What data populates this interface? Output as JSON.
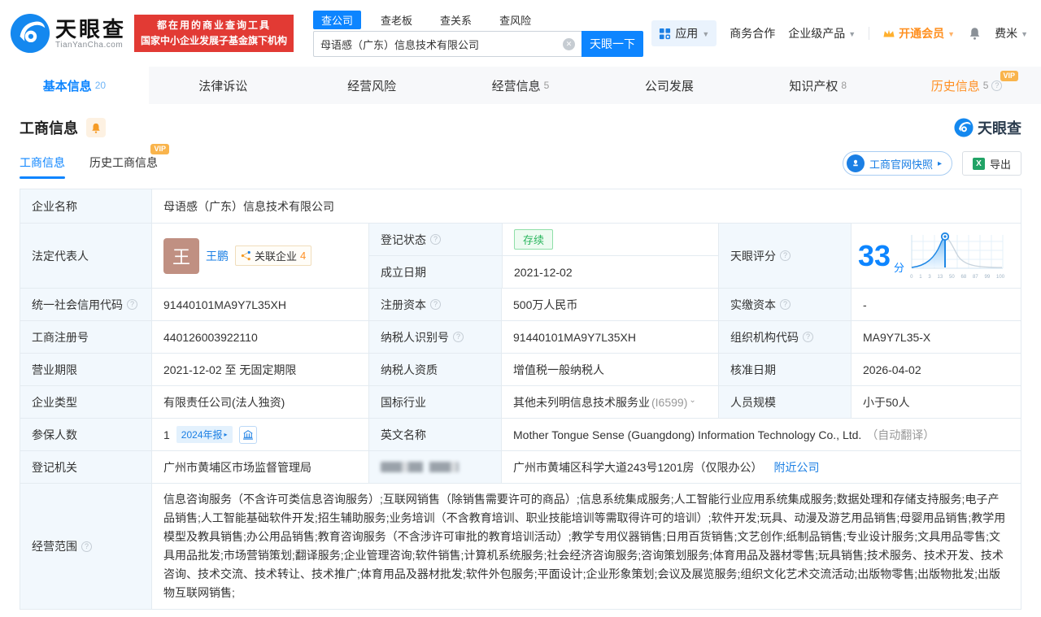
{
  "brand": {
    "name": "天眼查",
    "domain": "TianYanCha.com",
    "slogan1": "都在用的商业查询工具",
    "slogan2": "国家中小企业发展子基金旗下机构"
  },
  "search": {
    "tabs": [
      "查公司",
      "查老板",
      "查关系",
      "查风险"
    ],
    "value": "母语感（广东）信息技术有限公司",
    "button": "天眼一下"
  },
  "topnav": {
    "apps": "应用",
    "cooperation": "商务合作",
    "enterprise": "企业级产品",
    "vip": "开通会员",
    "username": "费米"
  },
  "tabs": [
    {
      "label": "基本信息",
      "count": "20"
    },
    {
      "label": "法律诉讼",
      "count": ""
    },
    {
      "label": "经营风险",
      "count": ""
    },
    {
      "label": "经营信息",
      "count": "5"
    },
    {
      "label": "公司发展",
      "count": ""
    },
    {
      "label": "知识产权",
      "count": "8"
    },
    {
      "label": "历史信息",
      "count": "5",
      "vip": "VIP"
    }
  ],
  "section": {
    "title": "工商信息",
    "watermark": "天眼查",
    "subtab1": "工商信息",
    "subtab2": "历史工商信息",
    "vip_badge": "VIP",
    "snapshot_btn": "工商官网快照",
    "export_btn": "导出"
  },
  "info": {
    "company_name_label": "企业名称",
    "company_name": "母语感（广东）信息技术有限公司",
    "legal_rep_label": "法定代表人",
    "legal_rep_avatar": "王",
    "legal_rep_name": "王鹏",
    "related_label": "关联企业",
    "related_count": "4",
    "reg_status_label": "登记状态",
    "reg_status": "存续",
    "establish_label": "成立日期",
    "establish": "2021-12-02",
    "score_label": "天眼评分",
    "score": "33",
    "score_unit": "分",
    "credit_code_label": "统一社会信用代码",
    "credit_code": "91440101MA9Y7L35XH",
    "reg_capital_label": "注册资本",
    "reg_capital": "500万人民币",
    "paid_capital_label": "实缴资本",
    "paid_capital": "-",
    "reg_no_label": "工商注册号",
    "reg_no": "440126003922110",
    "tax_id_label": "纳税人识别号",
    "tax_id": "91440101MA9Y7L35XH",
    "org_code_label": "组织机构代码",
    "org_code": "MA9Y7L35-X",
    "term_label": "营业期限",
    "term": "2021-12-02 至 无固定期限",
    "tax_quality_label": "纳税人资质",
    "tax_quality": "增值税一般纳税人",
    "approve_label": "核准日期",
    "approve": "2026-04-02",
    "type_label": "企业类型",
    "type": "有限责任公司(法人独资)",
    "industry_label": "国标行业",
    "industry": "其他未列明信息技术服务业",
    "industry_code": "(I6599)",
    "staff_label": "人员规模",
    "staff": "小于50人",
    "insured_label": "参保人数",
    "insured": "1",
    "annual_report": "2024年报",
    "en_name_label": "英文名称",
    "en_name": "Mother Tongue Sense (Guangdong) Information Technology Co., Ltd.",
    "en_note": "（自动翻译）",
    "authority_label": "登记机关",
    "authority": "广州市黄埔区市场监督管理局",
    "address": "广州市黄埔区科学大道243号1201房（仅限办公）",
    "nearby": "附近公司",
    "scope_label": "经营范围",
    "scope": "信息咨询服务（不含许可类信息咨询服务）;互联网销售（除销售需要许可的商品）;信息系统集成服务;人工智能行业应用系统集成服务;数据处理和存储支持服务;电子产品销售;人工智能基础软件开发;招生辅助服务;业务培训（不含教育培训、职业技能培训等需取得许可的培训）;软件开发;玩具、动漫及游艺用品销售;母婴用品销售;教学用模型及教具销售;办公用品销售;教育咨询服务（不含涉许可审批的教育培训活动）;教学专用仪器销售;日用百货销售;文艺创作;纸制品销售;专业设计服务;文具用品零售;文具用品批发;市场营销策划;翻译服务;企业管理咨询;软件销售;计算机系统服务;社会经济咨询服务;咨询策划服务;体育用品及器材零售;玩具销售;技术服务、技术开发、技术咨询、技术交流、技术转让、技术推广;体育用品及器材批发;软件外包服务;平面设计;企业形象策划;会议及展览服务;组织文化艺术交流活动;出版物零售;出版物批发;出版物互联网销售;"
  },
  "chart_data": {
    "type": "area",
    "title": "天眼评分分布曲线",
    "marker_value": 33,
    "x_labels": [
      "0",
      "1",
      "3",
      "13",
      "50",
      "68",
      "87",
      "99",
      "100"
    ],
    "xlim": [
      0,
      100
    ],
    "grid": true,
    "legend_position": "none"
  },
  "colors": {
    "accent": "#0d85ff",
    "orange": "#ff9024",
    "green": "#2bb65e",
    "red": "#e23a34"
  }
}
